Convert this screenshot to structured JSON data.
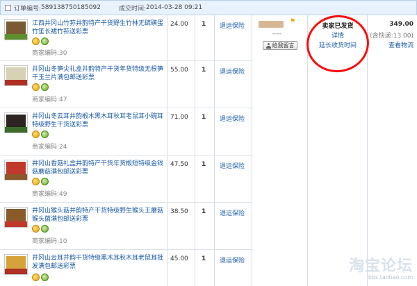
{
  "header": {
    "order_no_label": "订单编号:",
    "order_no": "589138750185092",
    "deal_time_label": "成交时间:",
    "deal_time": "2014-03-28 09:21"
  },
  "items": [
    {
      "title": "江西井冈山竹荪井韵特产干货野生竹林无硫磺蛋竹笙长裙竹荪送彩票",
      "code_label": "商家编码:",
      "code": "30",
      "price": "24.00",
      "qty": "1",
      "service": "退运保险"
    },
    {
      "title": "井冈山冬笋尖礼盒井韵特产干货年货特级无根笋干玉兰片满包邮送彩票",
      "code_label": "商家编码:",
      "code": "47",
      "price": "55.00",
      "qty": "1",
      "service": "退运保险"
    },
    {
      "title": "井冈山冬云耳井韵椴木黑木耳秋耳老鼠耳小碗耳特级野生干货送彩票",
      "code_label": "商家编码:",
      "code": "24",
      "price": "71.00",
      "qty": "1",
      "service": "退运保险"
    },
    {
      "title": "井冈山香菇礼盒井韵特产干货年货椴短特级金钱菇蘑菇满包邮送彩票",
      "code_label": "商家编码:",
      "code": "49",
      "price": "47.50",
      "qty": "1",
      "service": "退运保险"
    },
    {
      "title": "井冈山猴头菇井韵特产干货特级野生猴头王蘑菇猴头菌满包邮送彩票",
      "code_label": "商家编码:",
      "code": "10",
      "price": "38.50",
      "qty": "1",
      "service": "退运保险"
    },
    {
      "title": "井冈山云耳井韵干货特级黑木耳秋木耳老鼠耳批发满包邮送彩票",
      "code_label": "",
      "code": "",
      "price": "45.00",
      "qty": "1",
      "service": "退运保险"
    }
  ],
  "seller": {
    "dash": "----",
    "msg_button": "给我留言"
  },
  "status": {
    "main": "卖家已发货",
    "detail_link": "详情",
    "extend_link": "延长收货时间"
  },
  "total": {
    "amount": "349.00",
    "shipping": "(含快递:13.00)",
    "logistics_link": "查看物流"
  },
  "watermark": {
    "main": "淘宝论坛",
    "sub": "bbs.taobao.com"
  },
  "colors": {
    "link": "#1a5aa6",
    "header_bg": "#e8f2ff",
    "highlight_circle": "#ff0a0a"
  }
}
